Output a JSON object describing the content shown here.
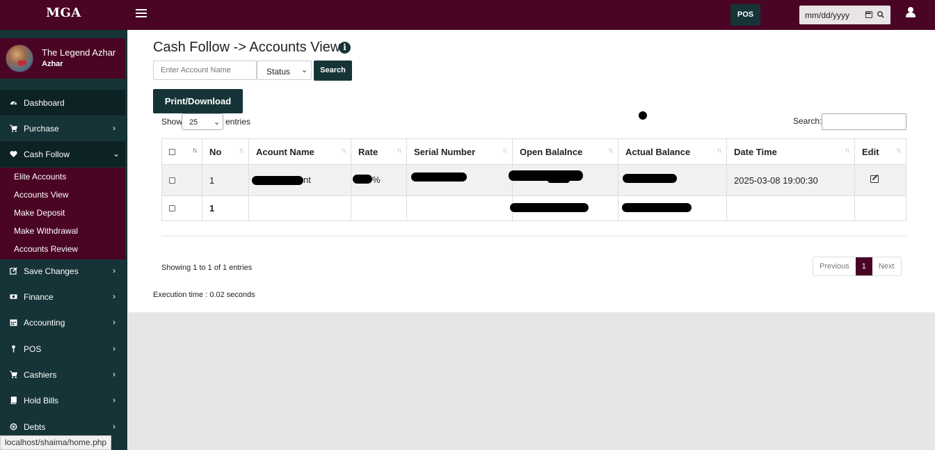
{
  "topbar": {
    "brand": "MGA",
    "pos_label": "POS",
    "date_placeholder": "mm/dd/yyyy"
  },
  "sidebar": {
    "profile": {
      "name": "The Legend Azhar",
      "subtitle": "Azhar"
    },
    "items": [
      {
        "label": "Dashboard",
        "icon": "dashboard-icon"
      },
      {
        "label": "Purchase",
        "icon": "cart-icon"
      },
      {
        "label": "Cash Follow",
        "icon": "heart-icon"
      },
      {
        "label": "Save Changes",
        "icon": "edit-icon"
      },
      {
        "label": "Finance",
        "icon": "money-icon"
      },
      {
        "label": "Accounting",
        "icon": "calendar-icon"
      },
      {
        "label": "POS",
        "icon": "pin-icon"
      },
      {
        "label": "Cashiers",
        "icon": "cart-icon"
      },
      {
        "label": "Hold Bills",
        "icon": "book-icon"
      },
      {
        "label": "Debts",
        "icon": "circle-dot-icon"
      }
    ],
    "submenu": [
      "Elite Accounts",
      "Accounts View",
      "Make Deposit",
      "Make Withdrawal",
      "Accounts Review"
    ]
  },
  "statusbar": {
    "url": "localhost/shaima/home.php"
  },
  "main": {
    "title": "Cash Follow -> Accounts View",
    "account_placeholder": "Enter Account Name",
    "status_select": "Status",
    "search_button": "Search",
    "print_button": "Print/Download",
    "show_label": "Show",
    "show_value": "25",
    "entries_label": "entries",
    "search_label": "Search:",
    "columns": [
      "No",
      "Acount Name",
      "Rate",
      "Serial Number",
      "Open Balalnce",
      "Actual Balance",
      "Date Time",
      "Edit"
    ],
    "rows": [
      {
        "no": "1",
        "account_name_tail": "nt",
        "rate_suffix": "%",
        "date_time": "2025-03-08 19:00:30"
      },
      {
        "no": "1"
      }
    ],
    "showing": "Showing 1 to 1 of 1 entries",
    "pager": {
      "previous": "Previous",
      "current": "1",
      "next": "Next"
    },
    "execution": "Execution time : 0.02 seconds"
  }
}
